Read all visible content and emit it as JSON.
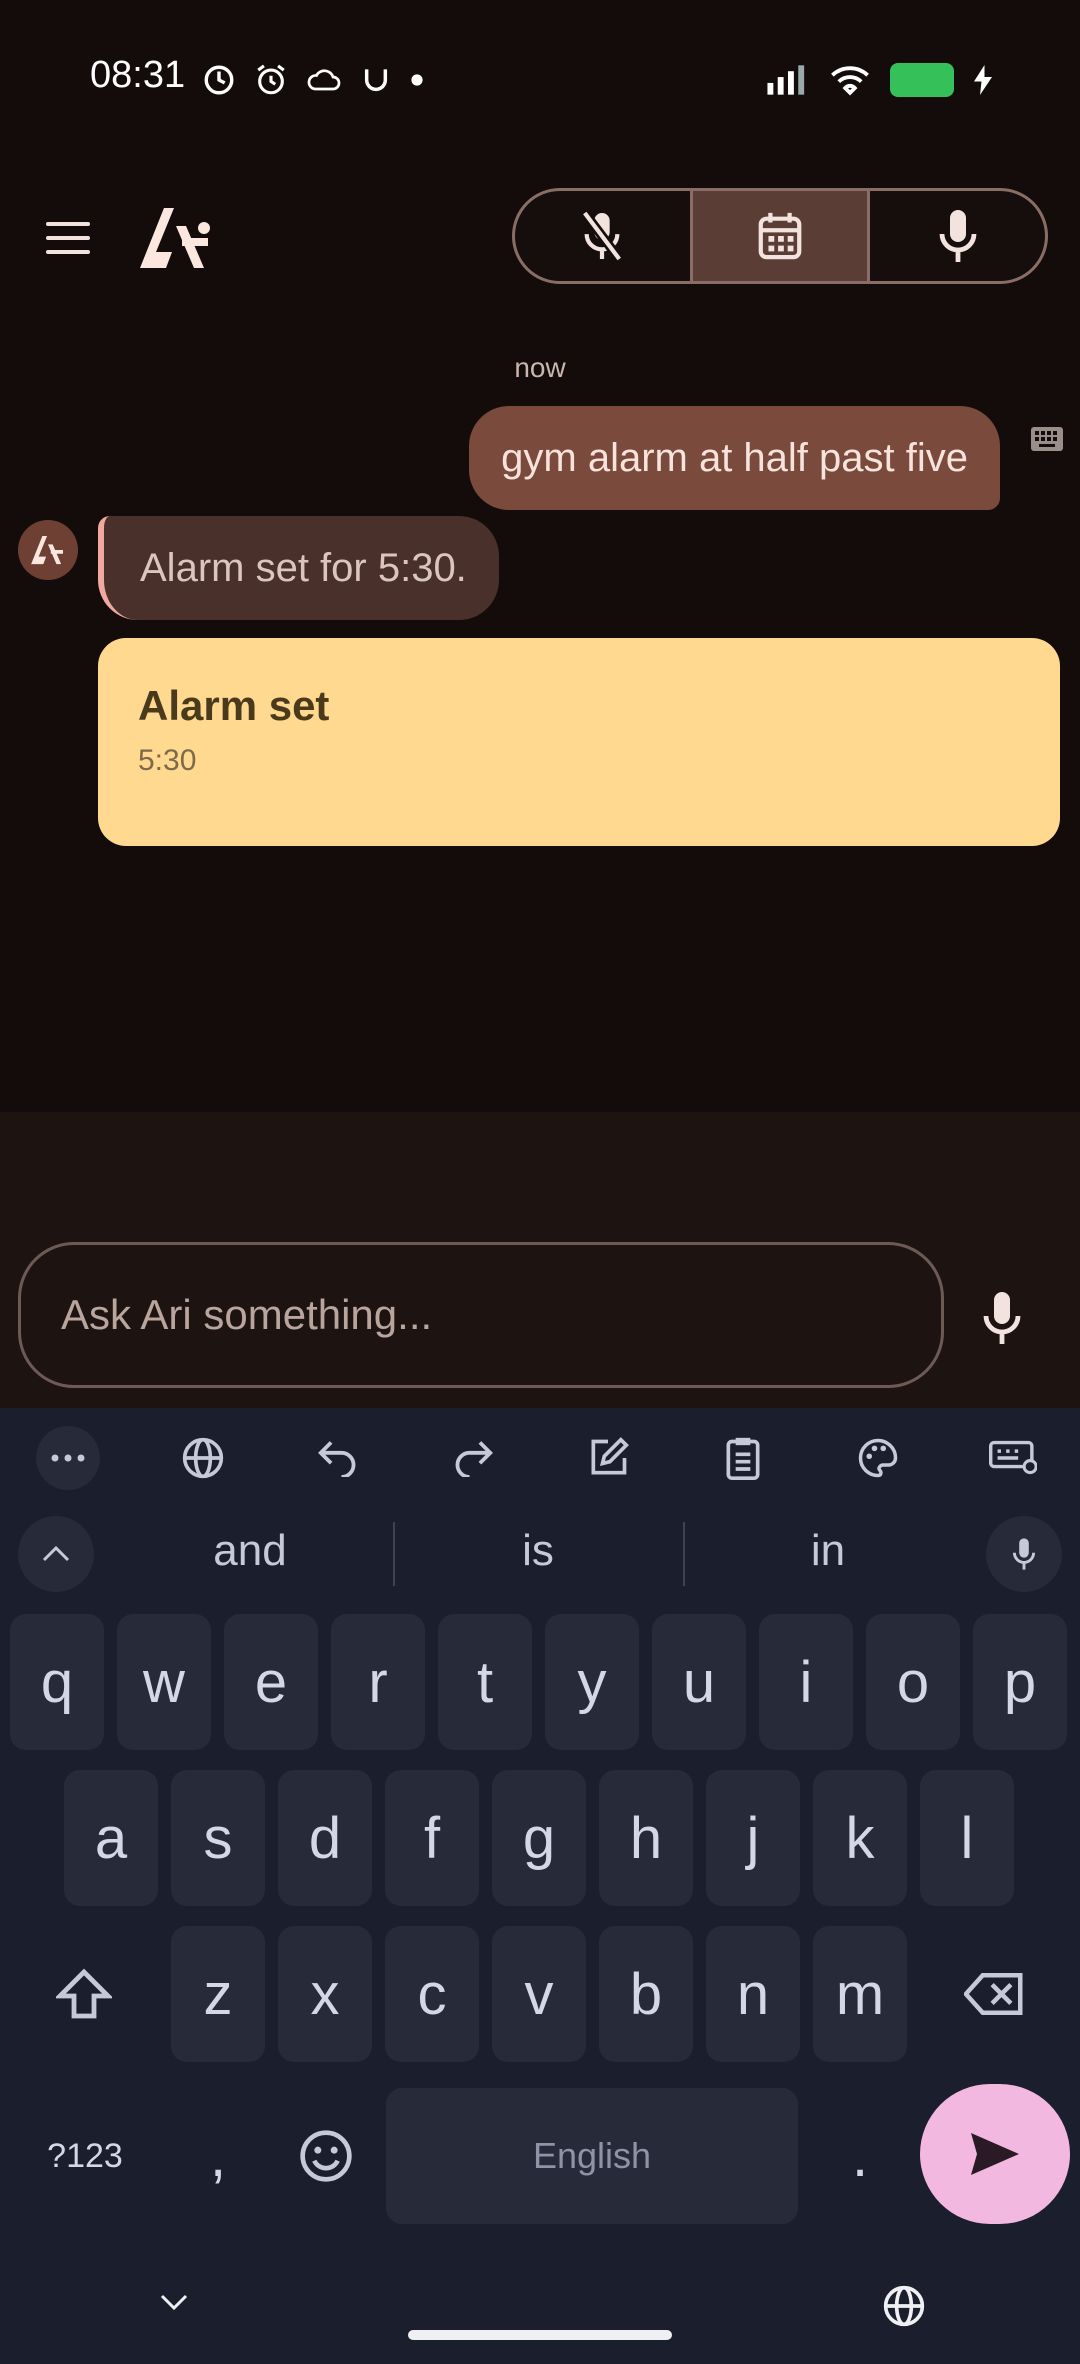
{
  "status_bar": {
    "time": "08:31"
  },
  "header": {
    "mode_buttons": [
      {
        "icon": "mic-off-icon",
        "active": false
      },
      {
        "icon": "calendar-icon",
        "active": true
      },
      {
        "icon": "mic-icon",
        "active": false
      }
    ]
  },
  "chat": {
    "timestamp": "now",
    "user_message": "gym alarm at half past five",
    "bot_message": "Alarm set for 5:30.",
    "card": {
      "title": "Alarm set",
      "subtitle": "5:30"
    }
  },
  "composer": {
    "placeholder": "Ask Ari something..."
  },
  "keyboard": {
    "suggestions": [
      "and",
      "is",
      "in"
    ],
    "row1": [
      "q",
      "w",
      "e",
      "r",
      "t",
      "y",
      "u",
      "i",
      "o",
      "p"
    ],
    "row2": [
      "a",
      "s",
      "d",
      "f",
      "g",
      "h",
      "j",
      "k",
      "l"
    ],
    "row3": [
      "z",
      "x",
      "c",
      "v",
      "b",
      "n",
      "m"
    ],
    "symbols_label": "?123",
    "comma": ",",
    "period": ".",
    "space_label": "English"
  },
  "colors": {
    "accent_user": "#7a4a3c",
    "card": "#ffd990",
    "send": "#f3b8df"
  }
}
